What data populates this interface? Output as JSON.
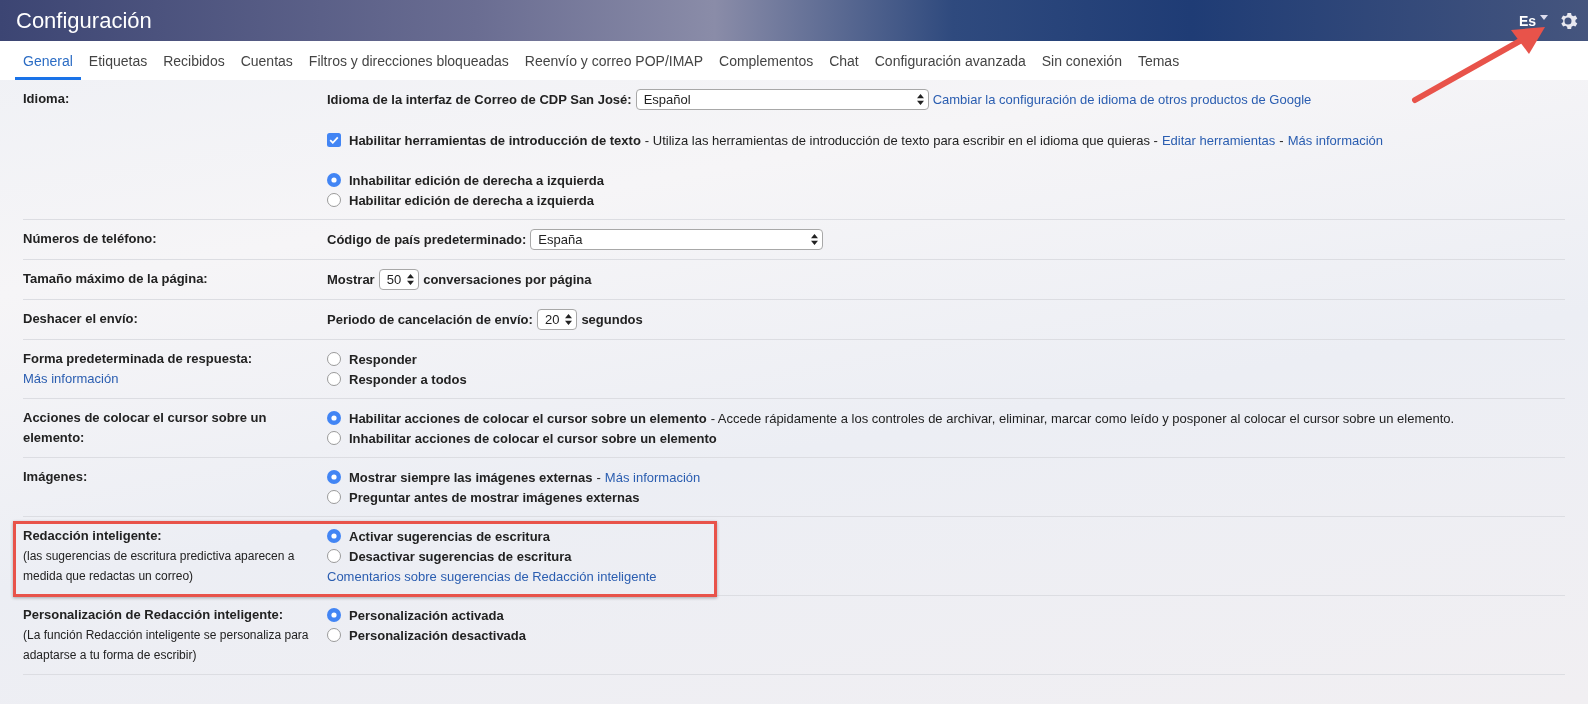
{
  "header": {
    "title": "Configuración",
    "language": "Es",
    "settings_arrow": true
  },
  "tabs": [
    {
      "label": "General",
      "selected": true
    },
    {
      "label": "Etiquetas",
      "selected": false
    },
    {
      "label": "Recibidos",
      "selected": false
    },
    {
      "label": "Cuentas",
      "selected": false
    },
    {
      "label": "Filtros y direcciones bloqueadas",
      "selected": false
    },
    {
      "label": "Reenvío y correo POP/IMAP",
      "selected": false
    },
    {
      "label": "Complementos",
      "selected": false
    },
    {
      "label": "Chat",
      "selected": false
    },
    {
      "label": "Configuración avanzada",
      "selected": false
    },
    {
      "label": "Sin conexión",
      "selected": false
    },
    {
      "label": "Temas",
      "selected": false
    }
  ],
  "sections": [
    {
      "label": "Idioma:",
      "highlighted": false,
      "blocks": [
        [
          {
            "kind": "plain",
            "parts": [
              {
                "kind": "strong",
                "text": "Idioma de la interfaz de Correo de CDP San José:"
              },
              {
                "kind": "select",
                "value": "Español"
              },
              {
                "kind": "link",
                "text": "Cambiar la configuración de idioma de otros productos de Google"
              }
            ]
          }
        ],
        [
          {
            "kind": "checkbox",
            "checked": true,
            "parts": [
              {
                "kind": "strong",
                "text": "Habilitar herramientas de introducción de texto"
              },
              {
                "kind": "text",
                "text": "- Utiliza las herramientas de introducción de texto para escribir en el idioma que quieras -"
              },
              {
                "kind": "link",
                "text": "Editar herramientas"
              },
              {
                "kind": "text",
                "text": "-"
              },
              {
                "kind": "link",
                "text": "Más información"
              }
            ]
          }
        ],
        [
          {
            "kind": "radio",
            "selected": true,
            "parts": [
              {
                "kind": "strong",
                "text": "Inhabilitar edición de derecha a izquierda"
              }
            ]
          },
          {
            "kind": "radio",
            "selected": false,
            "parts": [
              {
                "kind": "strong",
                "text": "Habilitar edición de derecha a izquierda"
              }
            ]
          }
        ]
      ]
    },
    {
      "label": "Números de teléfono:",
      "highlighted": false,
      "blocks": [
        [
          {
            "kind": "plain",
            "parts": [
              {
                "kind": "strong",
                "text": "Código de país predeterminado:"
              },
              {
                "kind": "select",
                "value": "España"
              }
            ]
          }
        ]
      ]
    },
    {
      "label": "Tamaño máximo de la página:",
      "highlighted": false,
      "blocks": [
        [
          {
            "kind": "plain",
            "parts": [
              {
                "kind": "strong",
                "text": "Mostrar"
              },
              {
                "kind": "select",
                "value": "50"
              },
              {
                "kind": "strong",
                "text": "conversaciones por página"
              }
            ]
          }
        ]
      ]
    },
    {
      "label": "Deshacer el envío:",
      "highlighted": false,
      "blocks": [
        [
          {
            "kind": "plain",
            "parts": [
              {
                "kind": "strong",
                "text": "Periodo de cancelación de envío:"
              },
              {
                "kind": "select",
                "value": "20"
              },
              {
                "kind": "strong",
                "text": "segundos"
              }
            ]
          }
        ]
      ]
    },
    {
      "label": "Forma predeterminada de respuesta:",
      "link": "Más información",
      "highlighted": false,
      "blocks": [
        [
          {
            "kind": "radio",
            "selected": false,
            "parts": [
              {
                "kind": "strong",
                "text": "Responder"
              }
            ]
          },
          {
            "kind": "radio",
            "selected": false,
            "parts": [
              {
                "kind": "strong",
                "text": "Responder a todos"
              }
            ]
          }
        ]
      ]
    },
    {
      "label": "Acciones de colocar el cursor sobre un elemento:",
      "highlighted": false,
      "blocks": [
        [
          {
            "kind": "radio",
            "selected": true,
            "parts": [
              {
                "kind": "strong",
                "text": "Habilitar acciones de colocar el cursor sobre un elemento"
              },
              {
                "kind": "text",
                "text": "- Accede rápidamente a los controles de archivar, eliminar, marcar como leído y posponer al colocar el cursor sobre un elemento."
              }
            ]
          },
          {
            "kind": "radio",
            "selected": false,
            "parts": [
              {
                "kind": "strong",
                "text": "Inhabilitar acciones de colocar el cursor sobre un elemento"
              }
            ]
          }
        ]
      ]
    },
    {
      "label": "Imágenes:",
      "highlighted": false,
      "blocks": [
        [
          {
            "kind": "radio",
            "selected": true,
            "parts": [
              {
                "kind": "strong",
                "text": "Mostrar siempre las imágenes externas"
              },
              {
                "kind": "text",
                "text": "-"
              },
              {
                "kind": "link",
                "text": "Más información"
              }
            ]
          },
          {
            "kind": "radio",
            "selected": false,
            "parts": [
              {
                "kind": "strong",
                "text": "Preguntar antes de mostrar imágenes externas"
              }
            ]
          }
        ]
      ]
    },
    {
      "label": "Redacción inteligente:",
      "note": "(las sugerencias de escritura predictiva aparecen a medida que redactas un correo)",
      "highlighted": true,
      "blocks": [
        [
          {
            "kind": "radio",
            "selected": true,
            "parts": [
              {
                "kind": "strong",
                "text": "Activar sugerencias de escritura"
              }
            ]
          },
          {
            "kind": "radio",
            "selected": false,
            "parts": [
              {
                "kind": "strong",
                "text": "Desactivar sugerencias de escritura"
              }
            ]
          },
          {
            "kind": "plain",
            "parts": [
              {
                "kind": "link",
                "text": "Comentarios sobre sugerencias de Redacción inteligente"
              }
            ]
          }
        ]
      ]
    },
    {
      "label": "Personalización de Redacción inteligente:",
      "note": "(La función Redacción inteligente se personaliza para adaptarse a tu forma de escribir)",
      "highlighted": false,
      "blocks": [
        [
          {
            "kind": "radio",
            "selected": true,
            "parts": [
              {
                "kind": "strong",
                "text": "Personalización activada"
              }
            ]
          },
          {
            "kind": "radio",
            "selected": false,
            "parts": [
              {
                "kind": "strong",
                "text": "Personalización desactivada"
              }
            ]
          }
        ]
      ]
    }
  ]
}
